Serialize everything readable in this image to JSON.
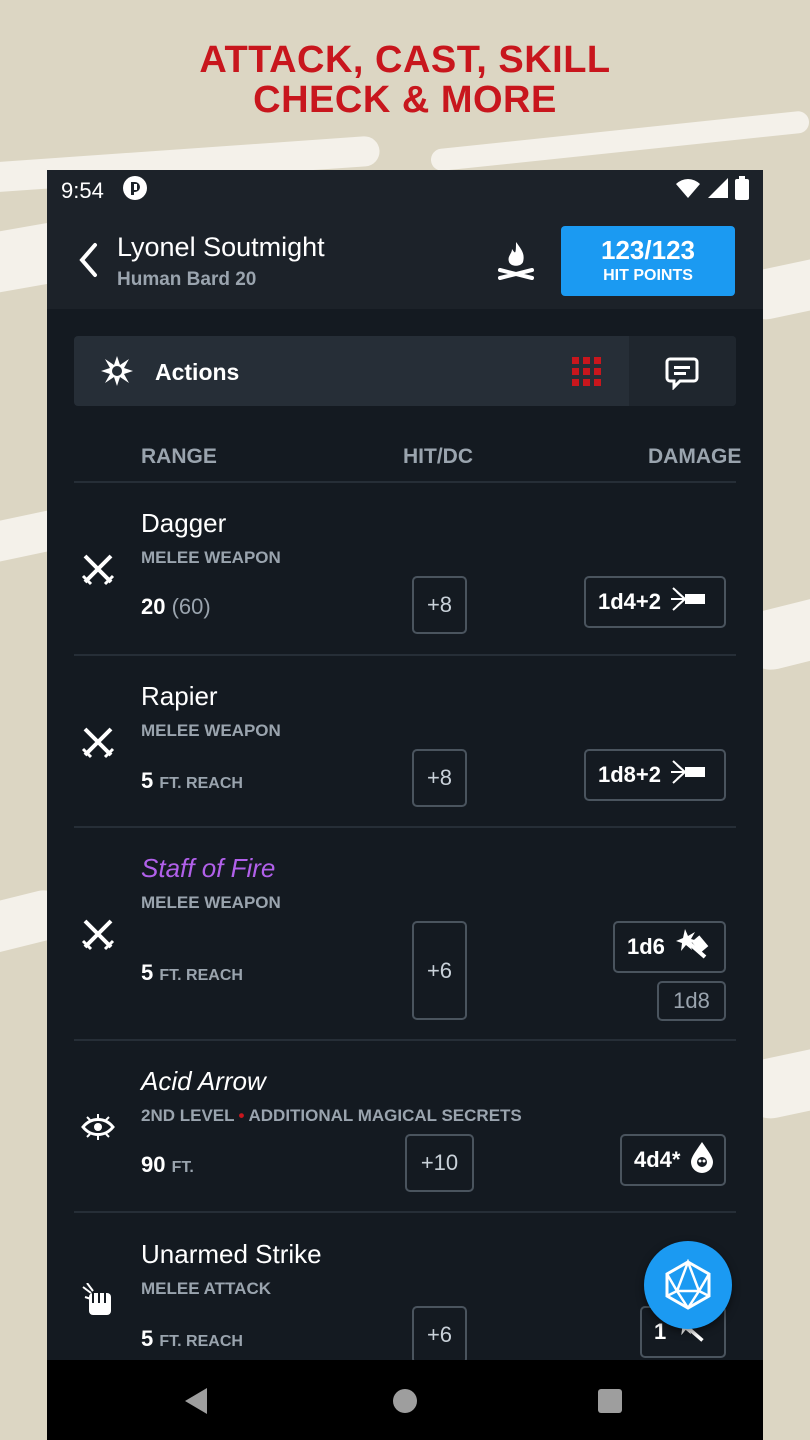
{
  "promo": {
    "line1": "ATTACK, CAST, SKILL",
    "line2": "CHECK & MORE"
  },
  "status": {
    "time": "9:54"
  },
  "header": {
    "name": "Lyonel Soutmight",
    "subtitle": "Human Bard 20",
    "hp_value": "123/123",
    "hp_label": "HIT POINTS"
  },
  "tabs": {
    "actions_label": "Actions"
  },
  "columns": {
    "range": "RANGE",
    "hit": "HIT/DC",
    "damage": "DAMAGE"
  },
  "rows": [
    {
      "name": "Dagger",
      "type": "MELEE WEAPON",
      "range": "20",
      "range_paren": "(60)",
      "hit": "+8",
      "damage": "1d4+2"
    },
    {
      "name": "Rapier",
      "type": "MELEE WEAPON",
      "range": "5",
      "range_unit": "FT. REACH",
      "hit": "+8",
      "damage": "1d8+2"
    },
    {
      "name": "Staff of Fire",
      "type": "MELEE WEAPON",
      "range": "5",
      "range_unit": "FT. REACH",
      "hit": "+6",
      "damage": "1d6",
      "damage2": "1d8"
    },
    {
      "name": "Acid Arrow",
      "level": "2ND LEVEL",
      "source": "ADDITIONAL MAGICAL SECRETS",
      "range": "90",
      "range_unit": "FT.",
      "hit": "+10",
      "damage": "4d4*"
    },
    {
      "name": "Unarmed Strike",
      "type": "MELEE ATTACK",
      "range": "5",
      "range_unit": "FT. REACH",
      "hit": "+6",
      "damage": "1"
    }
  ],
  "colors": {
    "accent": "#1b9af2",
    "brand_red": "#c8161d",
    "magic_item": "#b160ea",
    "background": "#141a21"
  }
}
